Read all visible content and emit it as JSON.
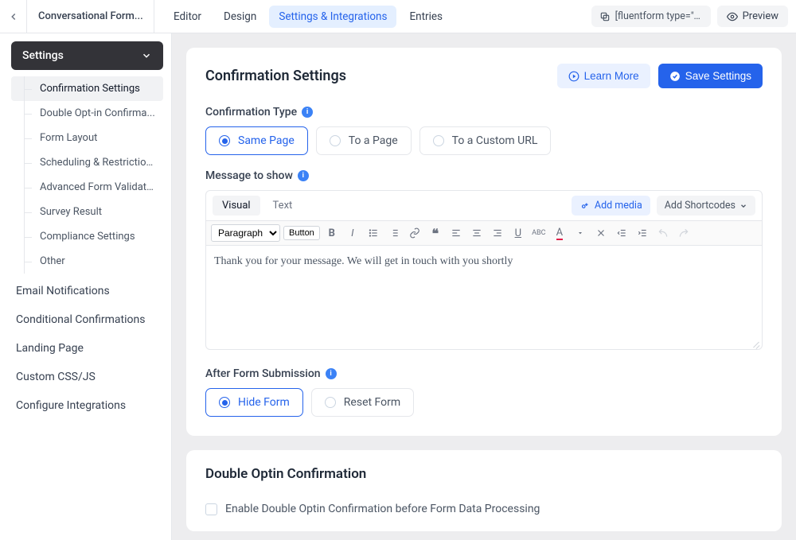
{
  "topbar": {
    "form_title": "Conversational Form...",
    "nav": {
      "editor": "Editor",
      "design": "Design",
      "settings": "Settings & Integrations",
      "entries": "Entries"
    },
    "shortcode": "[fluentform type=\"c...",
    "preview": "Preview"
  },
  "sidebar": {
    "header": "Settings",
    "tree": {
      "confirmation": "Confirmation Settings",
      "double_optin": "Double Opt-in Confirma...",
      "form_layout": "Form Layout",
      "scheduling": "Scheduling & Restrictions",
      "advanced": "Advanced Form Validati...",
      "survey": "Survey Result",
      "compliance": "Compliance Settings",
      "other": "Other"
    },
    "links": {
      "email_notifications": "Email Notifications",
      "conditional": "Conditional Confirmations",
      "landing_page": "Landing Page",
      "custom_css": "Custom CSS/JS",
      "configure": "Configure Integrations"
    }
  },
  "main": {
    "title": "Confirmation Settings",
    "learn_more": "Learn More",
    "save": "Save Settings",
    "confirmation_type": {
      "label": "Confirmation Type",
      "same_page": "Same Page",
      "to_page": "To a Page",
      "to_url": "To a Custom URL"
    },
    "message_label": "Message to show",
    "editor": {
      "tab_visual": "Visual",
      "tab_text": "Text",
      "add_media": "Add media",
      "add_shortcodes": "Add Shortcodes",
      "format_select": "Paragraph",
      "button_label": "Button",
      "content": "Thank you for your message. We will get in touch with you shortly"
    },
    "after_submission": {
      "label": "After Form Submission",
      "hide": "Hide Form",
      "reset": "Reset Form"
    }
  },
  "optin": {
    "title": "Double Optin Confirmation",
    "checkbox_label": "Enable Double Optin Confirmation before Form Data Processing"
  }
}
